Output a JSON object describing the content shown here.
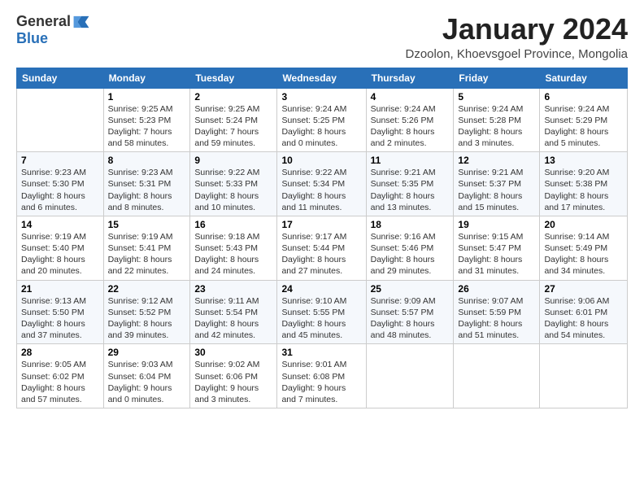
{
  "header": {
    "logo_general": "General",
    "logo_blue": "Blue",
    "month_title": "January 2024",
    "subtitle": "Dzoolon, Khoevsgoel Province, Mongolia"
  },
  "weekdays": [
    "Sunday",
    "Monday",
    "Tuesday",
    "Wednesday",
    "Thursday",
    "Friday",
    "Saturday"
  ],
  "weeks": [
    [
      {
        "day": "",
        "info": ""
      },
      {
        "day": "1",
        "info": "Sunrise: 9:25 AM\nSunset: 5:23 PM\nDaylight: 7 hours\nand 58 minutes."
      },
      {
        "day": "2",
        "info": "Sunrise: 9:25 AM\nSunset: 5:24 PM\nDaylight: 7 hours\nand 59 minutes."
      },
      {
        "day": "3",
        "info": "Sunrise: 9:24 AM\nSunset: 5:25 PM\nDaylight: 8 hours\nand 0 minutes."
      },
      {
        "day": "4",
        "info": "Sunrise: 9:24 AM\nSunset: 5:26 PM\nDaylight: 8 hours\nand 2 minutes."
      },
      {
        "day": "5",
        "info": "Sunrise: 9:24 AM\nSunset: 5:28 PM\nDaylight: 8 hours\nand 3 minutes."
      },
      {
        "day": "6",
        "info": "Sunrise: 9:24 AM\nSunset: 5:29 PM\nDaylight: 8 hours\nand 5 minutes."
      }
    ],
    [
      {
        "day": "7",
        "info": "Sunrise: 9:23 AM\nSunset: 5:30 PM\nDaylight: 8 hours\nand 6 minutes."
      },
      {
        "day": "8",
        "info": "Sunrise: 9:23 AM\nSunset: 5:31 PM\nDaylight: 8 hours\nand 8 minutes."
      },
      {
        "day": "9",
        "info": "Sunrise: 9:22 AM\nSunset: 5:33 PM\nDaylight: 8 hours\nand 10 minutes."
      },
      {
        "day": "10",
        "info": "Sunrise: 9:22 AM\nSunset: 5:34 PM\nDaylight: 8 hours\nand 11 minutes."
      },
      {
        "day": "11",
        "info": "Sunrise: 9:21 AM\nSunset: 5:35 PM\nDaylight: 8 hours\nand 13 minutes."
      },
      {
        "day": "12",
        "info": "Sunrise: 9:21 AM\nSunset: 5:37 PM\nDaylight: 8 hours\nand 15 minutes."
      },
      {
        "day": "13",
        "info": "Sunrise: 9:20 AM\nSunset: 5:38 PM\nDaylight: 8 hours\nand 17 minutes."
      }
    ],
    [
      {
        "day": "14",
        "info": "Sunrise: 9:19 AM\nSunset: 5:40 PM\nDaylight: 8 hours\nand 20 minutes."
      },
      {
        "day": "15",
        "info": "Sunrise: 9:19 AM\nSunset: 5:41 PM\nDaylight: 8 hours\nand 22 minutes."
      },
      {
        "day": "16",
        "info": "Sunrise: 9:18 AM\nSunset: 5:43 PM\nDaylight: 8 hours\nand 24 minutes."
      },
      {
        "day": "17",
        "info": "Sunrise: 9:17 AM\nSunset: 5:44 PM\nDaylight: 8 hours\nand 27 minutes."
      },
      {
        "day": "18",
        "info": "Sunrise: 9:16 AM\nSunset: 5:46 PM\nDaylight: 8 hours\nand 29 minutes."
      },
      {
        "day": "19",
        "info": "Sunrise: 9:15 AM\nSunset: 5:47 PM\nDaylight: 8 hours\nand 31 minutes."
      },
      {
        "day": "20",
        "info": "Sunrise: 9:14 AM\nSunset: 5:49 PM\nDaylight: 8 hours\nand 34 minutes."
      }
    ],
    [
      {
        "day": "21",
        "info": "Sunrise: 9:13 AM\nSunset: 5:50 PM\nDaylight: 8 hours\nand 37 minutes."
      },
      {
        "day": "22",
        "info": "Sunrise: 9:12 AM\nSunset: 5:52 PM\nDaylight: 8 hours\nand 39 minutes."
      },
      {
        "day": "23",
        "info": "Sunrise: 9:11 AM\nSunset: 5:54 PM\nDaylight: 8 hours\nand 42 minutes."
      },
      {
        "day": "24",
        "info": "Sunrise: 9:10 AM\nSunset: 5:55 PM\nDaylight: 8 hours\nand 45 minutes."
      },
      {
        "day": "25",
        "info": "Sunrise: 9:09 AM\nSunset: 5:57 PM\nDaylight: 8 hours\nand 48 minutes."
      },
      {
        "day": "26",
        "info": "Sunrise: 9:07 AM\nSunset: 5:59 PM\nDaylight: 8 hours\nand 51 minutes."
      },
      {
        "day": "27",
        "info": "Sunrise: 9:06 AM\nSunset: 6:01 PM\nDaylight: 8 hours\nand 54 minutes."
      }
    ],
    [
      {
        "day": "28",
        "info": "Sunrise: 9:05 AM\nSunset: 6:02 PM\nDaylight: 8 hours\nand 57 minutes."
      },
      {
        "day": "29",
        "info": "Sunrise: 9:03 AM\nSunset: 6:04 PM\nDaylight: 9 hours\nand 0 minutes."
      },
      {
        "day": "30",
        "info": "Sunrise: 9:02 AM\nSunset: 6:06 PM\nDaylight: 9 hours\nand 3 minutes."
      },
      {
        "day": "31",
        "info": "Sunrise: 9:01 AM\nSunset: 6:08 PM\nDaylight: 9 hours\nand 7 minutes."
      },
      {
        "day": "",
        "info": ""
      },
      {
        "day": "",
        "info": ""
      },
      {
        "day": "",
        "info": ""
      }
    ]
  ]
}
